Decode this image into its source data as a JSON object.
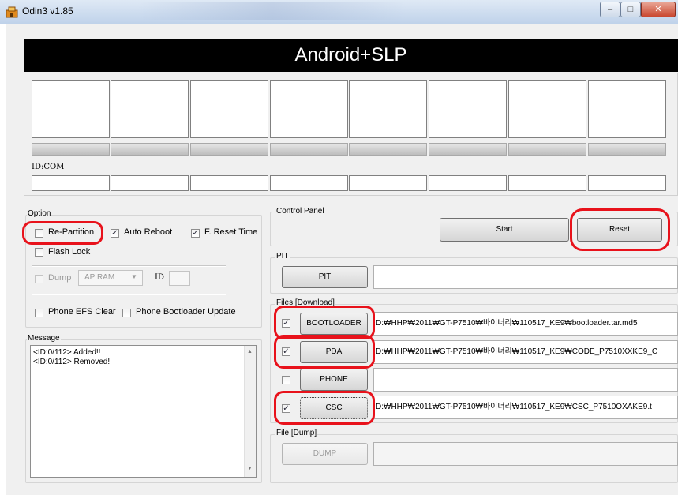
{
  "window": {
    "title": "Odin3 v1.85"
  },
  "banner": {
    "text": "Android+SLP"
  },
  "ports": {
    "id_label": "ID:COM"
  },
  "option": {
    "title": "Option",
    "re_partition": "Re-Partition",
    "auto_reboot": "Auto Reboot",
    "f_reset_time": "F. Reset Time",
    "flash_lock": "Flash Lock",
    "dump": "Dump",
    "dump_select": "AP RAM",
    "id_label": "ID",
    "phone_efs_clear": "Phone EFS Clear",
    "phone_bootloader_update": "Phone Bootloader Update",
    "checked": {
      "re_partition": false,
      "auto_reboot": true,
      "f_reset_time": true,
      "flash_lock": false,
      "dump": false,
      "phone_efs_clear": false,
      "phone_bootloader_update": false
    }
  },
  "message": {
    "title": "Message",
    "lines": [
      "<ID:0/112> Added!!",
      "<ID:0/112> Removed!!"
    ]
  },
  "control_panel": {
    "title": "Control Panel",
    "start": "Start",
    "reset": "Reset"
  },
  "pit": {
    "title": "PIT",
    "button": "PIT",
    "path": ""
  },
  "files": {
    "title": "Files [Download]",
    "bootloader": {
      "label": "BOOTLOADER",
      "checked": true,
      "path": "D:₩HHP₩2011₩GT-P7510₩바이너리₩110517_KE9₩bootloader.tar.md5"
    },
    "pda": {
      "label": "PDA",
      "checked": true,
      "path": "D:₩HHP₩2011₩GT-P7510₩바이너리₩110517_KE9₩CODE_P7510XXKE9_C"
    },
    "phone": {
      "label": "PHONE",
      "checked": false,
      "path": ""
    },
    "csc": {
      "label": "CSC",
      "checked": true,
      "path": "D:₩HHP₩2011₩GT-P7510₩바이너리₩110517_KE9₩CSC_P7510OXAKE9.t"
    }
  },
  "file_dump": {
    "title": "File [Dump]",
    "button": "DUMP",
    "path": ""
  },
  "colors": {
    "highlight_annotation": "#e8121b",
    "banner_bg": "#000000"
  }
}
